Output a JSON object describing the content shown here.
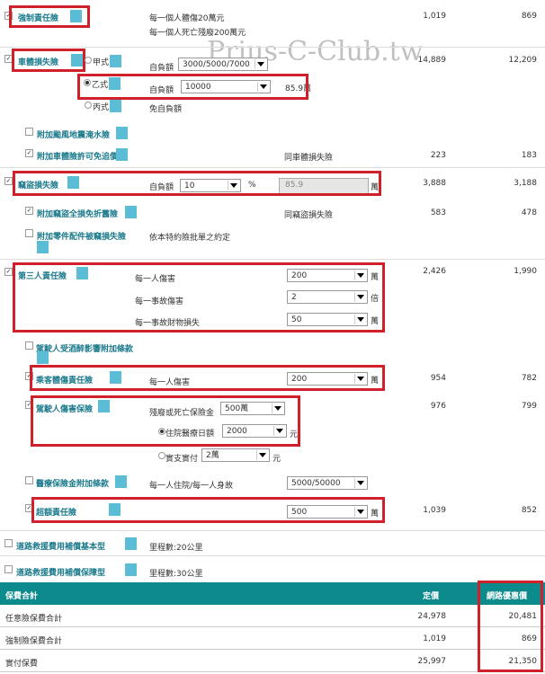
{
  "watermark": "Prius-C-Club.tw",
  "sections": {
    "compulsory": {
      "title": "強制責任險",
      "line1": "每一個人體傷20萬元",
      "line2": "每一個人死亡殘廢200萬元",
      "price": "1,019",
      "net": "869"
    },
    "body": {
      "title": "車體損失險",
      "type_a": "甲式",
      "type_b": "乙式",
      "type_c": "丙式",
      "deduct_label_a": "自負額",
      "deduct_val_a": "3000/5000/7000",
      "deduct_label_b": "自負額",
      "deduct_val_b": "10000",
      "amount_b": "85.9萬",
      "no_deduct": "免自負額",
      "price": "14,889",
      "net": "12,209"
    },
    "typhoon": {
      "title": "附加颱風地震淹水險"
    },
    "waiver": {
      "title": "附加車體險許可免追償",
      "note": "同車體損失險",
      "price": "223",
      "net": "183"
    },
    "theft": {
      "title": "竊盜損失險",
      "deduct_label": "自負額",
      "deduct_val": "10",
      "pct": "%",
      "amount": "85.9",
      "unit": "萬",
      "price": "3,888",
      "net": "3,188"
    },
    "theft_waiver": {
      "title": "附加竊盜全損免折舊險",
      "note": "同竊盜損失險",
      "price": "583",
      "net": "478"
    },
    "parts": {
      "title": "附加零件配件被竊損失險",
      "note": "依本特約險批單之約定"
    },
    "third": {
      "title": "第三人責任險",
      "l1": "每一人傷害",
      "v1": "200",
      "u1": "萬",
      "l2": "每一事故傷害",
      "v2": "2",
      "u2": "倍",
      "l3": "每一事故財物損失",
      "v3": "50",
      "u3": "萬",
      "price": "2,426",
      "net": "1,990"
    },
    "driver_ext": {
      "title": "駕駛人受酒醉影響附加條款"
    },
    "passenger": {
      "title": "乘客體傷責任險",
      "l1": "每一人傷害",
      "v1": "200",
      "u1": "萬",
      "price": "954",
      "net": "782"
    },
    "driver": {
      "title": "駕駛人傷害保險",
      "l1": "殘廢或死亡保險金",
      "v1": "500萬",
      "l2": "住院醫療日額",
      "v2": "2000",
      "u2": "元",
      "l3": "實支實付",
      "v3": "2萬",
      "u3": "元",
      "price": "976",
      "net": "799"
    },
    "medical": {
      "title": "醫療保險金附加條款",
      "l1": "每一人住院/每一人身故",
      "v1": "5000/50000"
    },
    "excess": {
      "title": "超額責任險",
      "v1": "500",
      "u1": "萬",
      "price": "1,039",
      "net": "852"
    },
    "road_basic": {
      "title": "道路救援費用補償基本型",
      "note": "里程數:20公里"
    },
    "road_plus": {
      "title": "道路救援費用補償保障型",
      "note": "里程數:30公里"
    }
  },
  "footer": {
    "hdr_title": "保費合計",
    "hdr_price": "定價",
    "hdr_net": "網路優惠價",
    "rows": [
      {
        "label": "任意險保費合計",
        "price": "24,978",
        "net": "20,481"
      },
      {
        "label": "強制險保費合計",
        "price": "1,019",
        "net": "869"
      },
      {
        "label": "實付保費",
        "price": "25,997",
        "net": "21,350"
      }
    ]
  }
}
